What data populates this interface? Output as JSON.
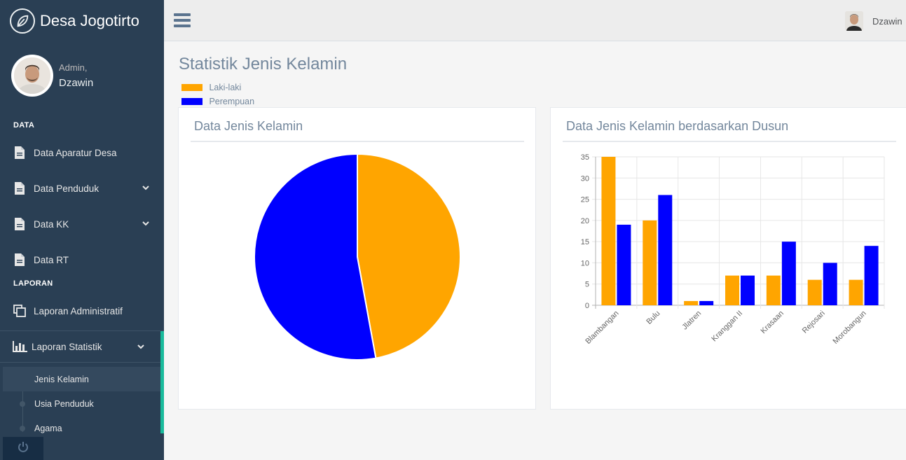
{
  "sidebar": {
    "brand": "Desa Jogotirto",
    "brand_icon": "leaf-icon",
    "profile": {
      "welcome": "Admin,",
      "name": "Dzawin"
    },
    "sections": {
      "data": "DATA",
      "laporan": "LAPORAN"
    },
    "items": [
      {
        "label": "Data Aparatur Desa",
        "icon": "document-icon"
      },
      {
        "label": "Data Penduduk",
        "icon": "document-icon"
      },
      {
        "label": "Data KK",
        "icon": "document-icon"
      },
      {
        "label": "Data RT",
        "icon": "document-icon"
      },
      {
        "label": "Laporan Administratif",
        "icon": "copy-icon"
      }
    ],
    "stat": {
      "label": "Laporan Statistik",
      "icon": "bar-chart-icon",
      "children": [
        {
          "label": "Jenis Kelamin",
          "active": true
        },
        {
          "label": "Usia Penduduk",
          "active": false
        },
        {
          "label": "Agama",
          "active": false
        }
      ]
    },
    "footer_icon": "power-icon"
  },
  "topnav": {
    "user_name": "Dzawin"
  },
  "page": {
    "title": "Statistik Jenis Kelamin",
    "legend": [
      {
        "label": "Laki-laki",
        "color": "#FFA500"
      },
      {
        "label": "Perempuan",
        "color": "#0000FF"
      }
    ]
  },
  "panels": {
    "pie_title": "Data Jenis Kelamin",
    "bar_title": "Data Jenis Kelamin berdasarkan Dusun"
  },
  "chart_data": [
    {
      "type": "pie",
      "categories": [
        "Laki-laki",
        "Perempuan"
      ],
      "values": [
        82,
        92
      ],
      "colors": [
        "#FFA500",
        "#0000FF"
      ]
    },
    {
      "type": "bar",
      "categories": [
        "Blambangan",
        "Bulu",
        "Jlatren",
        "Kranggan II",
        "Krasaan",
        "Rejosari",
        "Morobangun"
      ],
      "series": [
        {
          "name": "Laki-laki",
          "color": "#FFA500",
          "values": [
            35,
            20,
            1,
            7,
            7,
            6,
            6
          ]
        },
        {
          "name": "Perempuan",
          "color": "#0000FF",
          "values": [
            19,
            26,
            1,
            7,
            15,
            10,
            14
          ]
        }
      ],
      "yticks": [
        0,
        5,
        10,
        15,
        20,
        25,
        30,
        35
      ],
      "ylim": [
        0,
        35
      ],
      "grid": true,
      "legend": "top-left"
    }
  ]
}
